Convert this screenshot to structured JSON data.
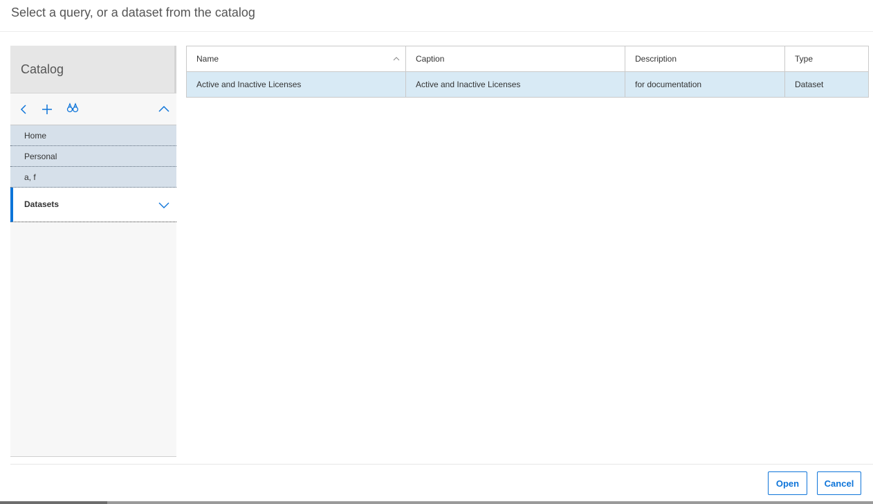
{
  "dialog": {
    "title": "Select a query, or a dataset from the catalog"
  },
  "sidebar": {
    "header": "Catalog",
    "toolbar": {
      "back_icon": "chevron-left-icon",
      "add_icon": "plus-icon",
      "find_icon": "binoculars-icon",
      "collapse_icon": "chevron-up-icon"
    },
    "items": [
      {
        "label": "Home"
      },
      {
        "label": "Personal"
      },
      {
        "label": "a, f"
      },
      {
        "label": "Datasets"
      }
    ]
  },
  "table": {
    "columns": [
      "Name",
      "Caption",
      "Description",
      "Type"
    ],
    "sort_column": "Name",
    "sort_direction": "ascending",
    "rows": [
      [
        "Active and Inactive Licenses",
        "Active and Inactive Licenses",
        "for documentation",
        "Dataset"
      ]
    ]
  },
  "footer": {
    "open_label": "Open",
    "cancel_label": "Cancel"
  },
  "colors": {
    "accent": "#0d74d9",
    "selected_row": "#d8eaf5",
    "nav_item_bg": "#d6e0ea"
  }
}
